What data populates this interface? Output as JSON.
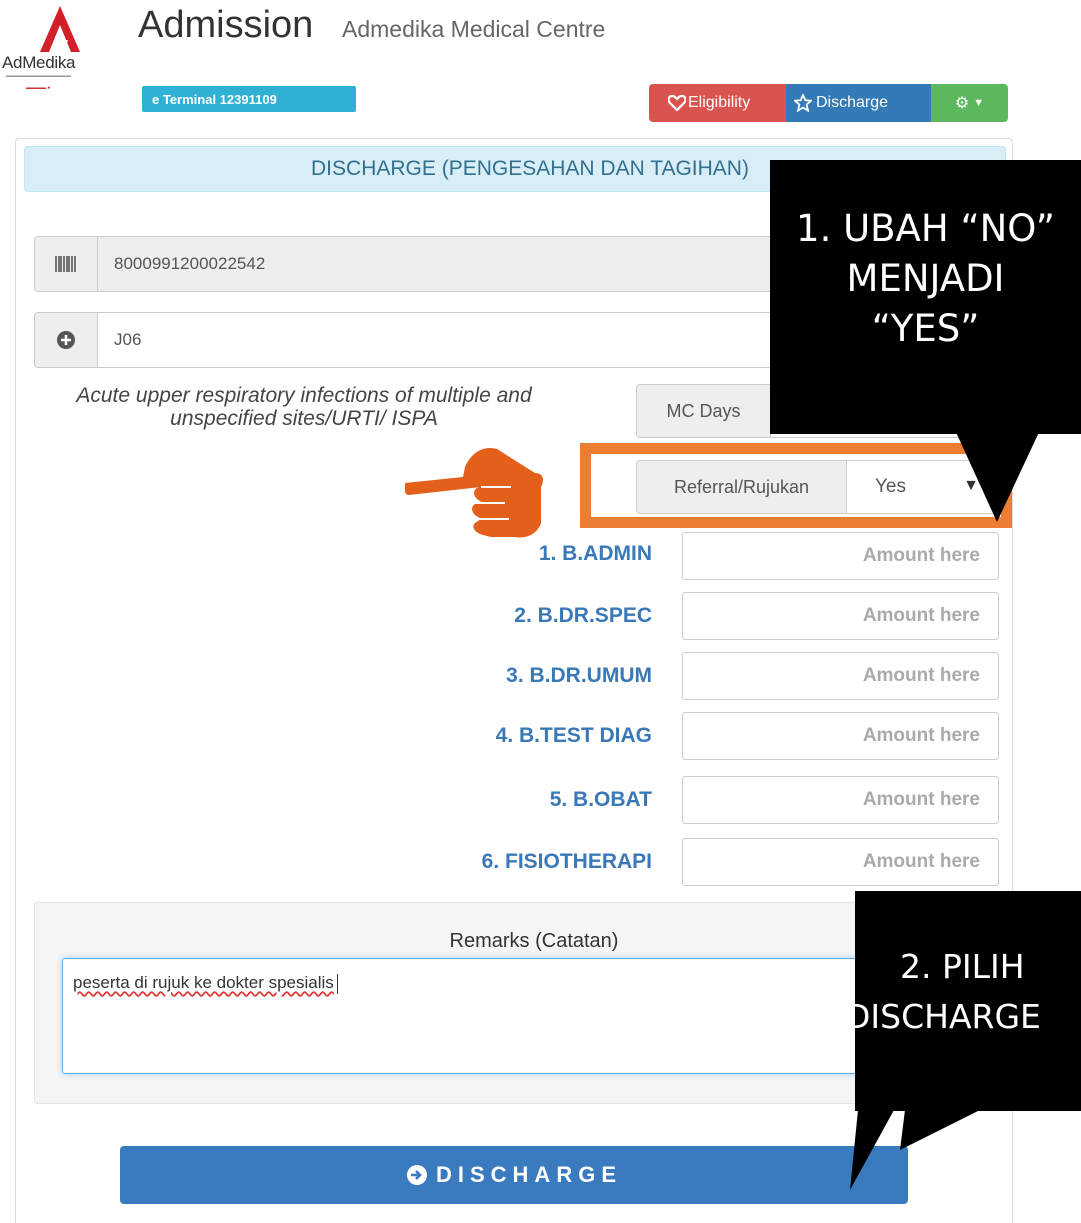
{
  "header": {
    "logo_text": "AdMedika",
    "title": "Admission",
    "subtitle": "Admedika Medical Centre",
    "terminal_badge": "e Terminal  12391109",
    "buttons": {
      "eligibility_label": "Eligibility",
      "discharge_label": "Discharge"
    }
  },
  "panel": {
    "heading": "DISCHARGE (PENGESAHAN DAN TAGIHAN)",
    "card_number": "8000991200022542",
    "diagnosis_code": "J06",
    "diagnosis_description": "Acute upper respiratory infections of multiple and unspecified sites/URTI/ ISPA",
    "mc_days_label": "MC Days",
    "mc_days_value": "...",
    "referral_label": "Referral/Rujukan",
    "referral_value": "Yes",
    "costs": [
      {
        "label": "1. B.ADMIN",
        "placeholder": "Amount here"
      },
      {
        "label": "2. B.DR.SPEC",
        "placeholder": "Amount here"
      },
      {
        "label": "3. B.DR.UMUM",
        "placeholder": "Amount here"
      },
      {
        "label": "4. B.TEST DIAG",
        "placeholder": "Amount here"
      },
      {
        "label": "5. B.OBAT",
        "placeholder": "Amount here"
      },
      {
        "label": "6. FISIOTHERAPI",
        "placeholder": "Amount here"
      }
    ],
    "remarks_label": "Remarks (Catatan)",
    "remarks_value": "peserta di rujuk ke dokter spesialis",
    "discharge_button": "DISCHARGE"
  },
  "callouts": {
    "step1": [
      "1. UBAH “NO”",
      "MENJADI",
      "“YES”"
    ],
    "step2": [
      "2. PILIH",
      "DISCHARGE"
    ]
  },
  "colors": {
    "eligibility": "#d9534f",
    "discharge": "#337ab7",
    "settings": "#5cb85c",
    "terminal": "#31b0d5",
    "highlight": "#ed7d31",
    "cost_label": "#3a78b8"
  }
}
